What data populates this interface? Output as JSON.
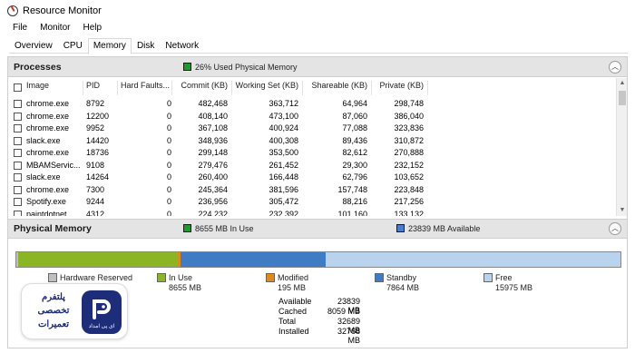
{
  "window": {
    "title": "Resource Monitor"
  },
  "menu": [
    "File",
    "Monitor",
    "Help"
  ],
  "tabs": [
    {
      "label": "Overview",
      "active": false
    },
    {
      "label": "CPU",
      "active": false
    },
    {
      "label": "Memory",
      "active": true
    },
    {
      "label": "Disk",
      "active": false
    },
    {
      "label": "Network",
      "active": false
    }
  ],
  "processes": {
    "title": "Processes",
    "status": "26% Used Physical Memory",
    "columns": [
      "Image",
      "PID",
      "Hard Faults...",
      "Commit (KB)",
      "Working Set (KB)",
      "Shareable (KB)",
      "Private (KB)"
    ],
    "rows": [
      [
        "chrome.exe",
        "8792",
        "0",
        "482,468",
        "363,712",
        "64,964",
        "298,748"
      ],
      [
        "chrome.exe",
        "12200",
        "0",
        "408,140",
        "473,100",
        "87,060",
        "386,040"
      ],
      [
        "chrome.exe",
        "9952",
        "0",
        "367,108",
        "400,924",
        "77,088",
        "323,836"
      ],
      [
        "slack.exe",
        "14420",
        "0",
        "348,936",
        "400,308",
        "89,436",
        "310,872"
      ],
      [
        "chrome.exe",
        "18736",
        "0",
        "299,148",
        "353,500",
        "82,612",
        "270,888"
      ],
      [
        "MBAMServic...",
        "9108",
        "0",
        "279,476",
        "261,452",
        "29,300",
        "232,152"
      ],
      [
        "slack.exe",
        "14264",
        "0",
        "260,400",
        "166,448",
        "62,796",
        "103,652"
      ],
      [
        "chrome.exe",
        "7300",
        "0",
        "245,364",
        "381,596",
        "157,748",
        "223,848"
      ],
      [
        "Spotify.exe",
        "9244",
        "0",
        "236,956",
        "305,472",
        "88,216",
        "217,256"
      ],
      [
        "paintdotnet...",
        "4312",
        "0",
        "224,232",
        "232,392",
        "101,160",
        "133,132"
      ]
    ]
  },
  "physical_memory": {
    "title": "Physical Memory",
    "in_use_label": "8655 MB In Use",
    "available_label": "23839 MB Available",
    "bar": {
      "hardware_reserved_mb": 79,
      "in_use_mb": 8655,
      "modified_mb": 195,
      "standby_mb": 7864,
      "free_mb": 15975,
      "installed_mb": 32768
    },
    "legend": [
      {
        "name": "Hardware Reserved",
        "value": "",
        "color": "#bfbfbf"
      },
      {
        "name": "In Use",
        "value": "8655 MB",
        "color": "#8bb524"
      },
      {
        "name": "Modified",
        "value": "195 MB",
        "color": "#e08a1e"
      },
      {
        "name": "Standby",
        "value": "7864 MB",
        "color": "#3f7cc4"
      },
      {
        "name": "Free",
        "value": "15975 MB",
        "color": "#b9d3ee"
      }
    ],
    "stats": [
      {
        "label": "Available",
        "value": "23839 MB"
      },
      {
        "label": "Cached",
        "value": "8059 MB"
      },
      {
        "label": "Total",
        "value": "32689 MB"
      },
      {
        "label": "Installed",
        "value": "32768 MB"
      }
    ]
  },
  "watermark": {
    "line1": "پلتفرم",
    "line2": "تخصصی",
    "line3": "تعمیرات",
    "badge": "ای پی امداد"
  },
  "colors": {
    "header_bg": "#e4e4e4",
    "status_green": "#1e9b2c",
    "status_blue": "#4a7ecb"
  },
  "icons": [
    "resource-monitor-icon",
    "collapse-chevron-up-icon",
    "scroll-up-icon",
    "scroll-down-icon"
  ]
}
